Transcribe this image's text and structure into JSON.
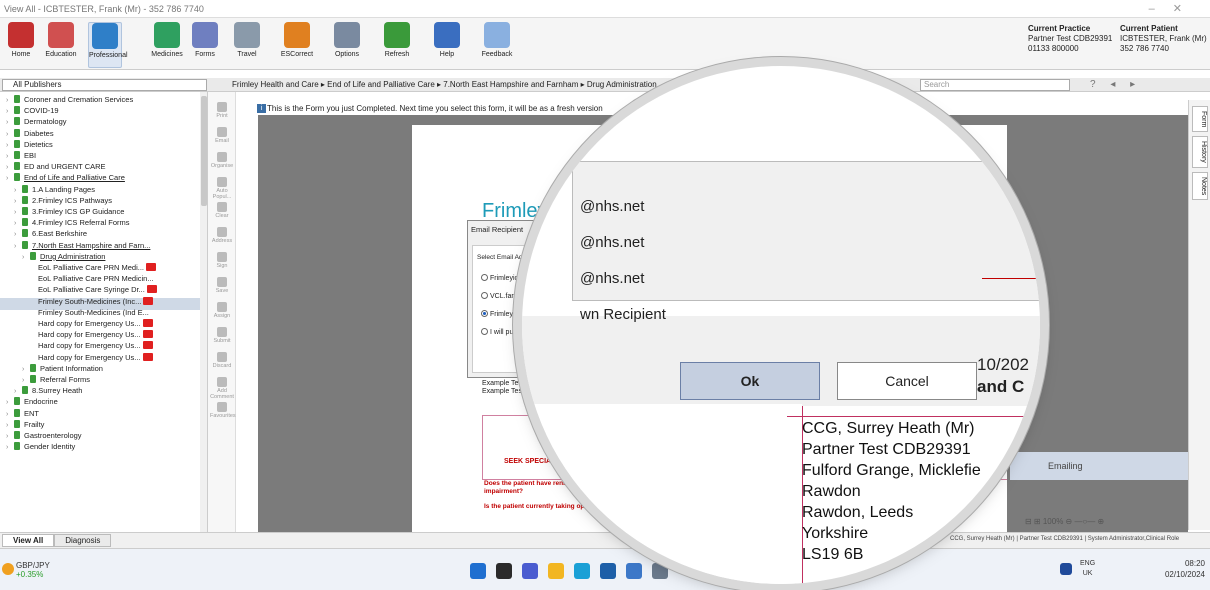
{
  "window": {
    "title": "View All - ICBTESTER, Frank (Mr) - 352 786 7740"
  },
  "ribbon": {
    "buttons": [
      {
        "label": "Home",
        "icon": "home-icon"
      },
      {
        "label": "Education",
        "icon": "education-icon"
      },
      {
        "label": "Professional",
        "icon": "professional-icon"
      },
      {
        "label": "Medicines",
        "icon": "medicines-icon"
      },
      {
        "label": "Forms",
        "icon": "forms-icon"
      },
      {
        "label": "Travel",
        "icon": "travel-icon"
      },
      {
        "label": "ESCorrect",
        "icon": "escorrect-icon"
      },
      {
        "label": "Options",
        "icon": "options-icon"
      },
      {
        "label": "Refresh",
        "icon": "refresh-icon"
      },
      {
        "label": "Help",
        "icon": "help-icon"
      },
      {
        "label": "Feedback",
        "icon": "feedback-icon"
      }
    ],
    "current_practice": {
      "heading": "Current Practice",
      "line1": "Partner Test CDB29391",
      "line2": "01133 800000"
    },
    "current_patient": {
      "heading": "Current Patient",
      "line1": "ICBTESTER, Frank (Mr)",
      "line2": "352 786 7740"
    }
  },
  "nav": {
    "publisher": "All Publishers",
    "breadcrumb": "Frimley Health and Care ▸ End of Life and Palliative Care ▸ 7.North East Hampshire and Farnham ▸ Drug Administration",
    "search_placeholder": "Search"
  },
  "tree": [
    {
      "label": "Coroner and Cremation Services",
      "level": 0
    },
    {
      "label": "COVID-19",
      "level": 0
    },
    {
      "label": "Dermatology",
      "level": 0
    },
    {
      "label": "Diabetes",
      "level": 0
    },
    {
      "label": "Dietetics",
      "level": 0
    },
    {
      "label": "EBI",
      "level": 0
    },
    {
      "label": "ED and URGENT CARE",
      "level": 0
    },
    {
      "label": "End of Life and Palliative Care",
      "level": 0,
      "u": true
    },
    {
      "label": "1.A Landing Pages",
      "level": 1
    },
    {
      "label": "2.Frimley ICS Pathways",
      "level": 1
    },
    {
      "label": "3.Frimley ICS GP Guidance",
      "level": 1
    },
    {
      "label": "4.Frimley ICS Referral Forms",
      "level": 1
    },
    {
      "label": "6.East Berkshire",
      "level": 1
    },
    {
      "label": "7.North East Hampshire and Farn...",
      "level": 1,
      "u": true
    },
    {
      "label": "Drug Administration",
      "level": 2,
      "u": true
    },
    {
      "label": "EoL Palliative Care PRN Medi...",
      "level": 3,
      "red": true
    },
    {
      "label": "EoL Palliative Care PRN Medicin...",
      "level": 3
    },
    {
      "label": "EoL Palliative Care Syringe Dr...",
      "level": 3,
      "red": true
    },
    {
      "label": "Frimley South-Medicines (Inc...",
      "level": 3,
      "red": true
    },
    {
      "label": "Frimley South-Medicines (Ind E...",
      "level": 3
    },
    {
      "label": "Hard copy for Emergency Us...",
      "level": 3,
      "red": true
    },
    {
      "label": "Hard copy for Emergency Us...",
      "level": 3,
      "red": true
    },
    {
      "label": "Hard copy for Emergency Us...",
      "level": 3,
      "red": true
    },
    {
      "label": "Hard copy for Emergency Us...",
      "level": 3,
      "red": true
    },
    {
      "label": "Patient Information",
      "level": 2
    },
    {
      "label": "Referral Forms",
      "level": 2
    },
    {
      "label": "8.Surrey Heath",
      "level": 1
    },
    {
      "label": "Endocrine",
      "level": 0
    },
    {
      "label": "ENT",
      "level": 0
    },
    {
      "label": "Frailty",
      "level": 0
    },
    {
      "label": "Gastroenterology",
      "level": 0
    },
    {
      "label": "Gender Identity",
      "level": 0
    }
  ],
  "tools": [
    "Print",
    "Email",
    "Organise",
    "Auto Popul...",
    "Clear",
    "Address",
    "Sign",
    "Save",
    "Assign",
    "Submit",
    "Discard",
    "Add Comment",
    "Favourites"
  ],
  "form": {
    "info": "This is the Form you just Completed.  Next time you select this form, it will be as a fresh version",
    "header": "Frimley H",
    "example1": "Example Test",
    "example2": "Example Test",
    "seesp": "SEEK SPECIALIST PA",
    "q1a": "Does the patient have rena",
    "q1b": "impairment?",
    "q2": "Is the patient currently taking op"
  },
  "dialog": {
    "title": "Email Recipient",
    "select_label": "Select Email Address T",
    "options": [
      "Frimleyicb.netf",
      "VCL.farnhampr",
      "Frimleyicb.shsp",
      "I will put in my"
    ],
    "selected_index": 2
  },
  "magnifier": {
    "emails": [
      "@nhs.net",
      "@nhs.net",
      "@nhs.net",
      "wn Recipient"
    ],
    "ok": "Ok",
    "cancel": "Cancel",
    "date_fragment": "10/202",
    "and_fragment": "and C",
    "address": [
      "CCG, Surrey Heath (Mr)",
      "Partner Test CDB29391",
      "Fulford Grange, Micklefie",
      "Rawdon",
      "Rawdon, Leeds",
      "Yorkshire",
      "LS19 6B"
    ]
  },
  "right_tabs": [
    "Form",
    "History",
    "Notes"
  ],
  "emailing": "Emailing",
  "zoom": "100%",
  "status": {
    "tab_viewall": "View All",
    "tab_diagnosis": "Diagnosis",
    "right": "CCG, Surrey Heath (Mr) | Partner Test CDB29391 | System Administrator,Clinical Role"
  },
  "taskbar": {
    "fx_pair": "GBP/JPY",
    "fx_change": "+0.35%",
    "lang1": "ENG",
    "lang2": "UK",
    "time": "08:20",
    "date": "02/10/2024"
  }
}
